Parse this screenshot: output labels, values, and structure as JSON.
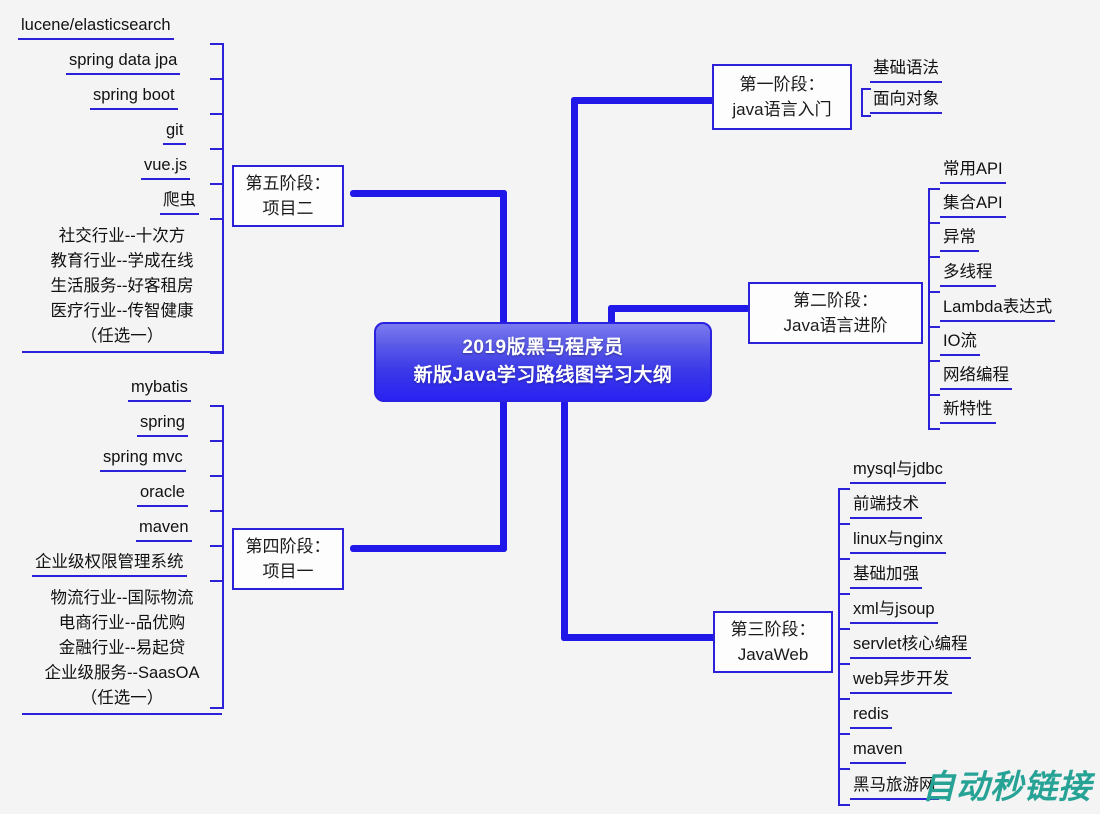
{
  "root": {
    "line1": "2019版黑马程序员",
    "line2": "新版Java学习路线图学习大纲",
    "accent_color": "#2018e8",
    "gradient_from": "#7b7bf0",
    "gradient_to": "#2a22f2",
    "text_color": "#ffffff"
  },
  "background_color": "#f4f4f4",
  "line_color": "#2b21d8",
  "watermark": {
    "text": "自动秒链接",
    "color": "#27a396"
  },
  "stages": {
    "stage1": {
      "line1": "第一阶段：",
      "line2": "java语言入门"
    },
    "stage2": {
      "line1": "第二阶段：",
      "line2": "Java语言进阶"
    },
    "stage3": {
      "line1": "第三阶段：",
      "line2": "JavaWeb"
    },
    "stage4": {
      "line1": "第四阶段：",
      "line2": "项目一"
    },
    "stage5": {
      "line1": "第五阶段：",
      "line2": "项目二"
    }
  },
  "stage1_items": [
    {
      "label": "基础语法"
    },
    {
      "label": "面向对象"
    }
  ],
  "stage2_items": [
    {
      "label": "常用API"
    },
    {
      "label": "集合API"
    },
    {
      "label": "异常"
    },
    {
      "label": "多线程"
    },
    {
      "label": "Lambda表达式"
    },
    {
      "label": "IO流"
    },
    {
      "label": "网络编程"
    },
    {
      "label": "新特性"
    }
  ],
  "stage3_items": [
    {
      "label": "mysql与jdbc"
    },
    {
      "label": "前端技术"
    },
    {
      "label": "linux与nginx"
    },
    {
      "label": "基础加强"
    },
    {
      "label": "xml与jsoup"
    },
    {
      "label": "servlet核心编程"
    },
    {
      "label": "web异步开发"
    },
    {
      "label": "redis"
    },
    {
      "label": "maven"
    },
    {
      "label": "黑马旅游网"
    }
  ],
  "stage5_items": [
    {
      "label": "lucene/elasticsearch"
    },
    {
      "label": "spring data jpa"
    },
    {
      "label": "spring boot"
    },
    {
      "label": "git"
    },
    {
      "label": "vue.js"
    },
    {
      "label": "爬虫"
    },
    {
      "label": "社交行业--十次方\n教育行业--学成在线\n生活服务--好客租房\n医疗行业--传智健康\n（任选一）"
    }
  ],
  "stage4_items": [
    {
      "label": "mybatis"
    },
    {
      "label": "spring"
    },
    {
      "label": "spring mvc"
    },
    {
      "label": "oracle"
    },
    {
      "label": "maven"
    },
    {
      "label": "企业级权限管理系统"
    },
    {
      "label": "物流行业--国际物流\n电商行业--品优购\n金融行业--易起贷\n企业级服务--SaasOA\n（任选一）"
    }
  ]
}
